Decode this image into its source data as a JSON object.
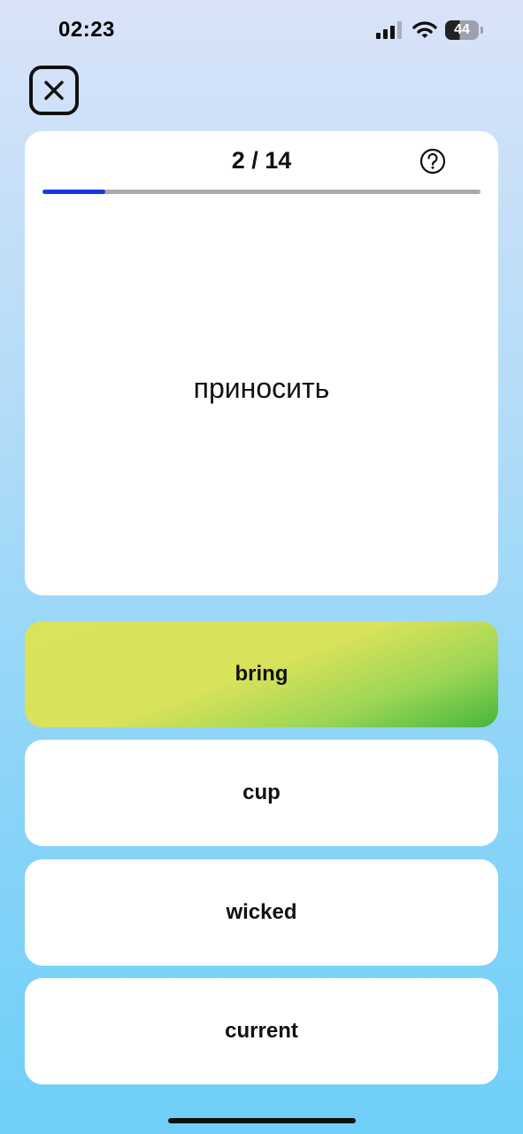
{
  "status_bar": {
    "time": "02:23",
    "battery_level": "44",
    "icons": [
      "signal-icon",
      "wifi-icon",
      "battery-icon"
    ]
  },
  "header": {
    "close_icon": "close-icon"
  },
  "quiz": {
    "counter": "2 / 14",
    "progress_fraction": 0.1429,
    "help_icon": "question-mark-icon",
    "word": "приносить"
  },
  "answers": [
    {
      "label": "bring",
      "state": "correct"
    },
    {
      "label": "cup",
      "state": "default"
    },
    {
      "label": "wicked",
      "state": "default"
    },
    {
      "label": "current",
      "state": "default"
    }
  ],
  "colors": {
    "progress_fill": "#1537e8",
    "progress_track": "#a9a9a9",
    "correct_answer_start": "#dbe35c",
    "correct_answer_end": "#46b53e"
  }
}
